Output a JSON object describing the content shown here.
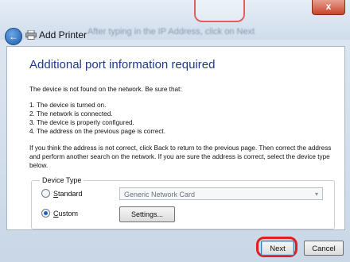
{
  "window": {
    "app_title": "Add Printer",
    "background_overlay_text": "After typing in the IP Address, click on Next",
    "close_glyph": "x"
  },
  "content": {
    "heading": "Additional port information required",
    "intro": "The device is not found on the network.  Be sure that:",
    "checklist": [
      "1.  The device is turned on.",
      "2.  The network is connected.",
      "3.  The device is properly configured.",
      "4.  The address on the previous page is correct."
    ],
    "instructions": "If you think the address is not correct, click Back to return to the previous page.  Then correct the address and perform another search on the network.  If you are sure the address is correct, select the device type below."
  },
  "device_type": {
    "label": "Device Type",
    "standard_label": "Standard",
    "standard_selected": false,
    "standard_value": "Generic Network Card",
    "custom_label": "Custom",
    "custom_selected": true,
    "settings_label": "Settings..."
  },
  "footer": {
    "next_label": "Next",
    "cancel_label": "Cancel"
  },
  "colors": {
    "heading": "#1e3a8a",
    "highlight": "#e02020",
    "radio_dot": "#1f62c4"
  },
  "icons": {
    "back": "back-arrow-icon",
    "printer": "printer-icon",
    "close": "close-icon",
    "dropdown": "chevron-down-icon"
  }
}
